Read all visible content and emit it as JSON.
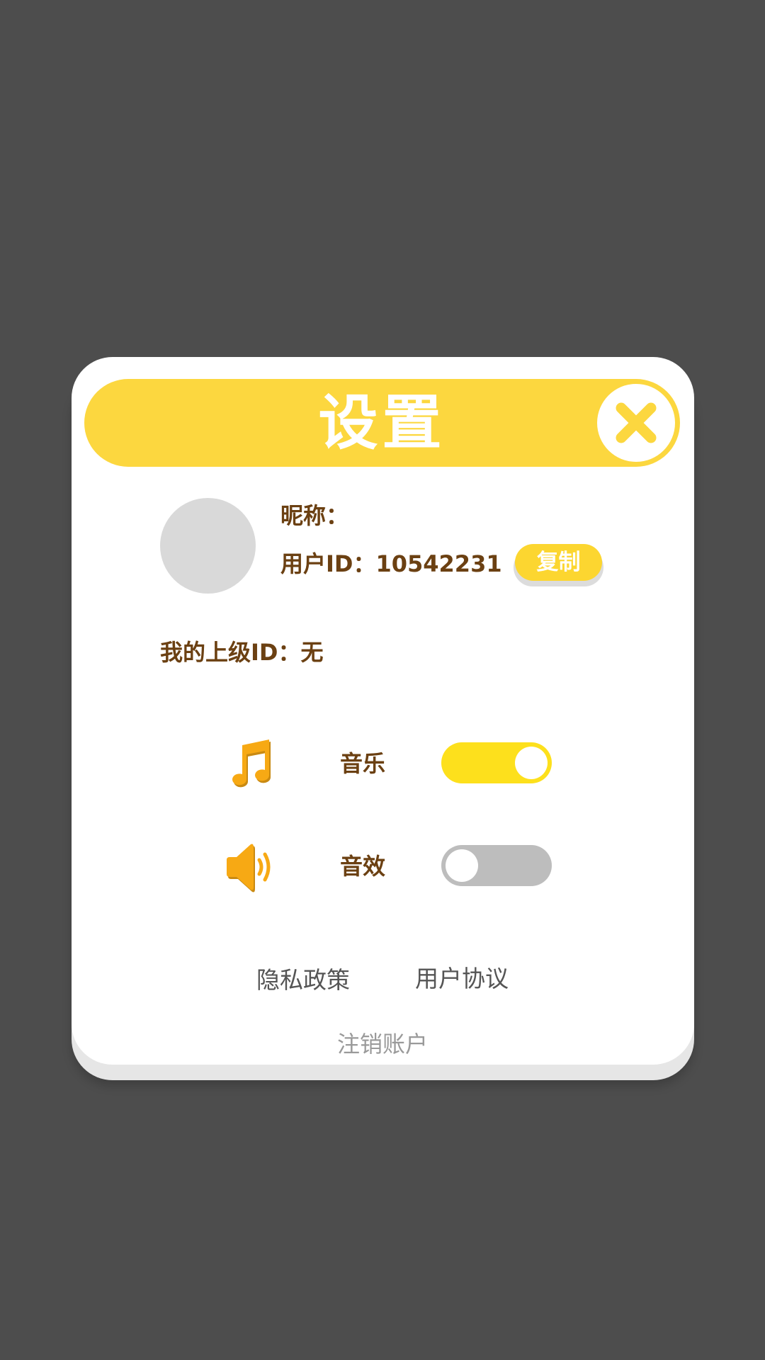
{
  "dialog": {
    "title": "设置",
    "close_icon": "close-x-icon"
  },
  "profile": {
    "nickname_label": "昵称：",
    "user_id_text": "用户ID：10542231",
    "copy_label": "复制",
    "parent_id_text": "我的上级ID：无"
  },
  "settings": {
    "music": {
      "icon": "music-note-icon",
      "label": "音乐",
      "enabled": true
    },
    "sound": {
      "icon": "speaker-icon",
      "label": "音效",
      "enabled": false
    }
  },
  "links": {
    "privacy": "隐私政策",
    "agreement": "用户协议",
    "deregister": "注销账户"
  },
  "colors": {
    "overlay": "#4d4d4d",
    "header": "#fcd73f",
    "toggle_on": "#fde01c",
    "toggle_off": "#bdbdbd",
    "text_brown": "#6b4012",
    "icon_orange": "#f7a914"
  }
}
